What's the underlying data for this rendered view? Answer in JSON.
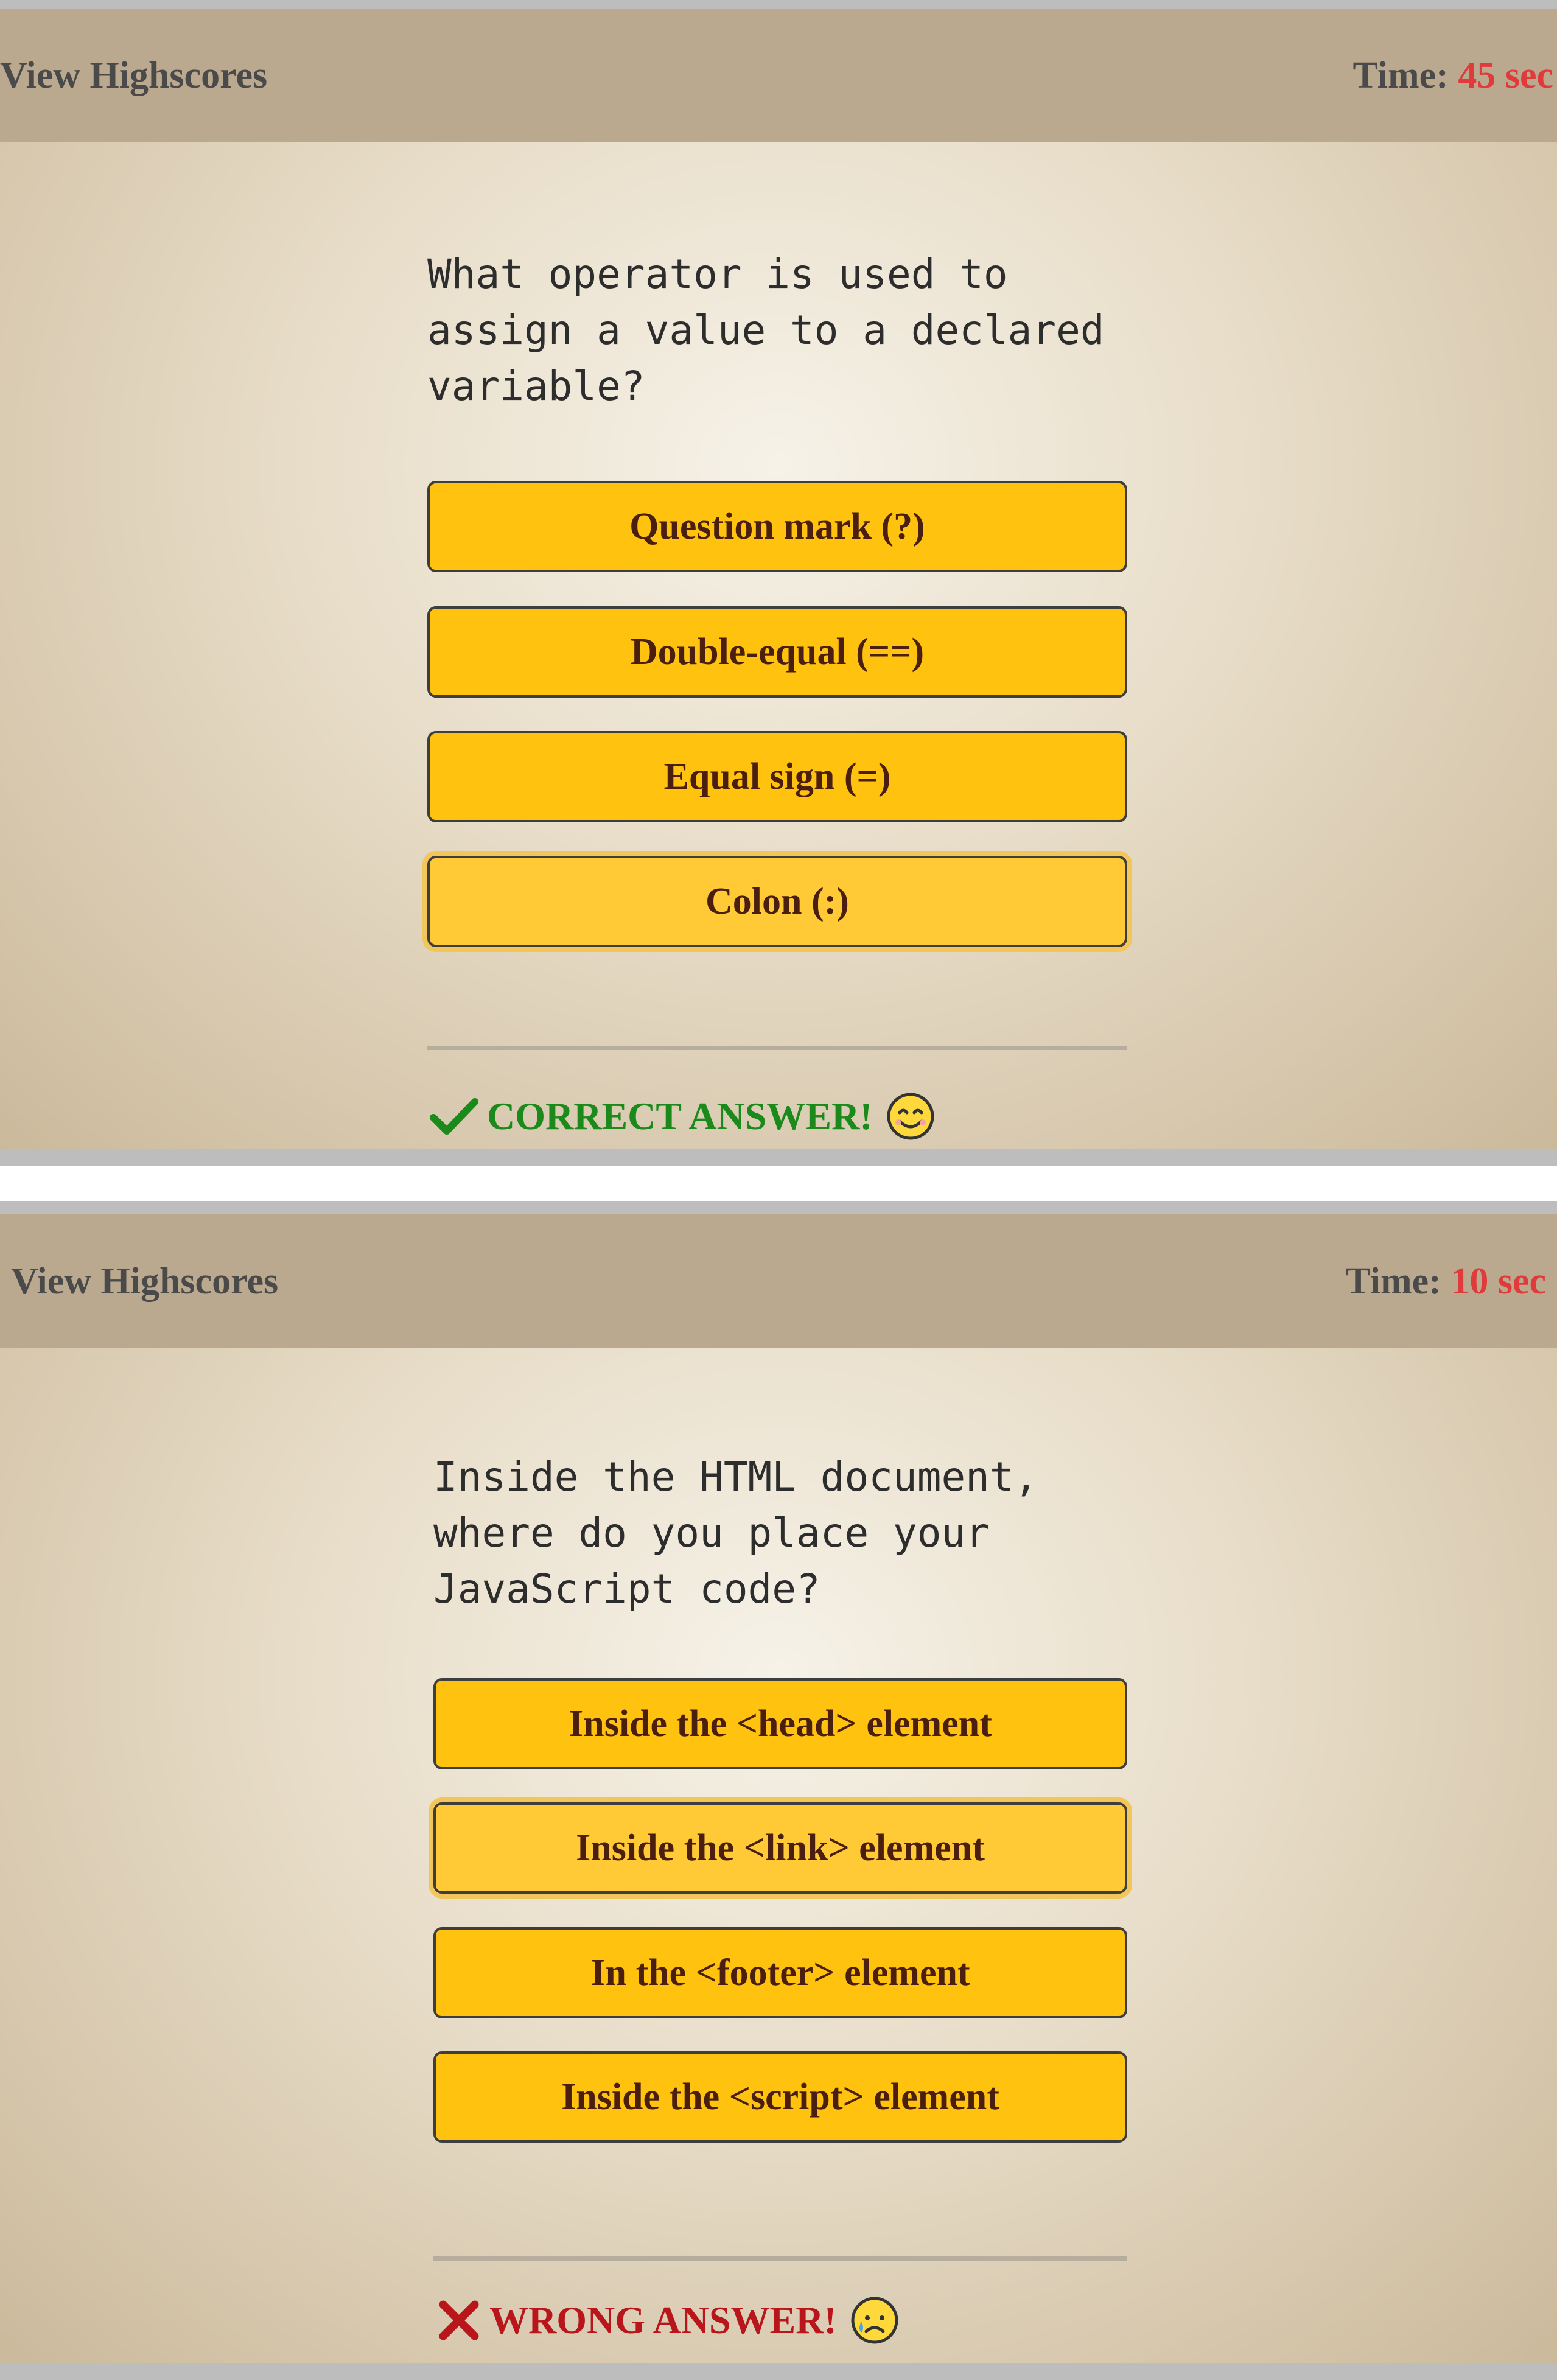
{
  "screens": [
    {
      "header": {
        "highscores_label": "View Highscores",
        "time_label": "Time:",
        "time_value": "45 sec"
      },
      "question": "What operator is used to assign a value to a declared variable?",
      "answers": [
        "Question mark (?)",
        "Double-equal (==)",
        "Equal sign (=)",
        "Colon (:)"
      ],
      "hovered_answer_index": 3,
      "feedback": {
        "text": "CORRECT ANSWER!",
        "status": "correct",
        "icon": "checkmark-icon",
        "emoji": "smiling-face-emoji",
        "color": "#1b8a1b"
      }
    },
    {
      "header": {
        "highscores_label": "View Highscores",
        "time_label": "Time:",
        "time_value": "10 sec"
      },
      "question": "Inside the HTML document, where do you place your JavaScript code?",
      "answers": [
        "Inside the <head> element",
        "Inside the <link> element",
        "In the <footer> element",
        "Inside the <script> element"
      ],
      "hovered_answer_index": 1,
      "feedback": {
        "text": "WRONG ANSWER!",
        "status": "wrong",
        "icon": "cross-icon",
        "emoji": "sad-face-emoji",
        "color": "#b8161a"
      }
    }
  ],
  "colors": {
    "answer_button": "#ffc20e",
    "answer_text": "#4a1f0f",
    "timer_value": "#e03a3a",
    "header_bg": "#bba98f"
  }
}
